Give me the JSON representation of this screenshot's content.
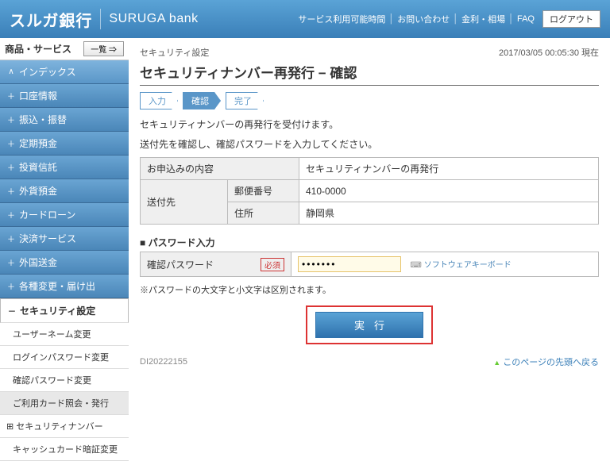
{
  "header": {
    "logo_jp": "スルガ銀行",
    "logo_en": "SURUGA bank",
    "links": [
      "サービス利用可能時間",
      "お問い合わせ",
      "金利・相場",
      "FAQ"
    ],
    "logout": "ログアウト"
  },
  "sidebar": {
    "head": "商品・サービス",
    "ichiran": "一覧 ⇒",
    "items": [
      {
        "mark": "∧",
        "label": "インデックス"
      },
      {
        "mark": "＋",
        "label": "口座情報"
      },
      {
        "mark": "＋",
        "label": "振込・振替"
      },
      {
        "mark": "＋",
        "label": "定期預金"
      },
      {
        "mark": "＋",
        "label": "投資信託"
      },
      {
        "mark": "＋",
        "label": "外貨預金"
      },
      {
        "mark": "＋",
        "label": "カードローン"
      },
      {
        "mark": "＋",
        "label": "決済サービス"
      },
      {
        "mark": "＋",
        "label": "外国送金"
      },
      {
        "mark": "＋",
        "label": "各種変更・届け出"
      },
      {
        "mark": "－",
        "label": "セキュリティ設定"
      }
    ],
    "subitems": [
      "ユーザーネーム変更",
      "ログインパスワード変更",
      "確認パスワード変更",
      "ご利用カード照会・発行"
    ],
    "subtree": {
      "mark": "⊞",
      "label": "セキュリティナンバー"
    },
    "sublast": "キャッシュカード暗証変更"
  },
  "main": {
    "crumb": "セキュリティ設定",
    "timestamp": "2017/03/05  00:05:30 現在",
    "title": "セキュリティナンバー再発行 − 確認",
    "steps": [
      "入力",
      "確認",
      "完了"
    ],
    "msg1": "セキュリティナンバーの再発行を受付けます。",
    "msg2": "送付先を確認し、確認パスワードを入力してください。",
    "table": {
      "r1h": "お申込みの内容",
      "r1v": "セキュリティナンバーの再発行",
      "r2h": "送付先",
      "r2a": "郵便番号",
      "r2av": "410-0000",
      "r2b": "住所",
      "r2bv": "静岡県"
    },
    "pw_section": "■ パスワード入力",
    "pw_label": "確認パスワード",
    "pw_req": "必須",
    "pw_value": "●●●●●●●",
    "soft_kb": "ソフトウェアキーボード",
    "note": "※パスワードの大文字と小文字は区別されます。",
    "exec": "実行",
    "screen_id": "DI20222155",
    "back_top": "このページの先頭へ戻る"
  }
}
